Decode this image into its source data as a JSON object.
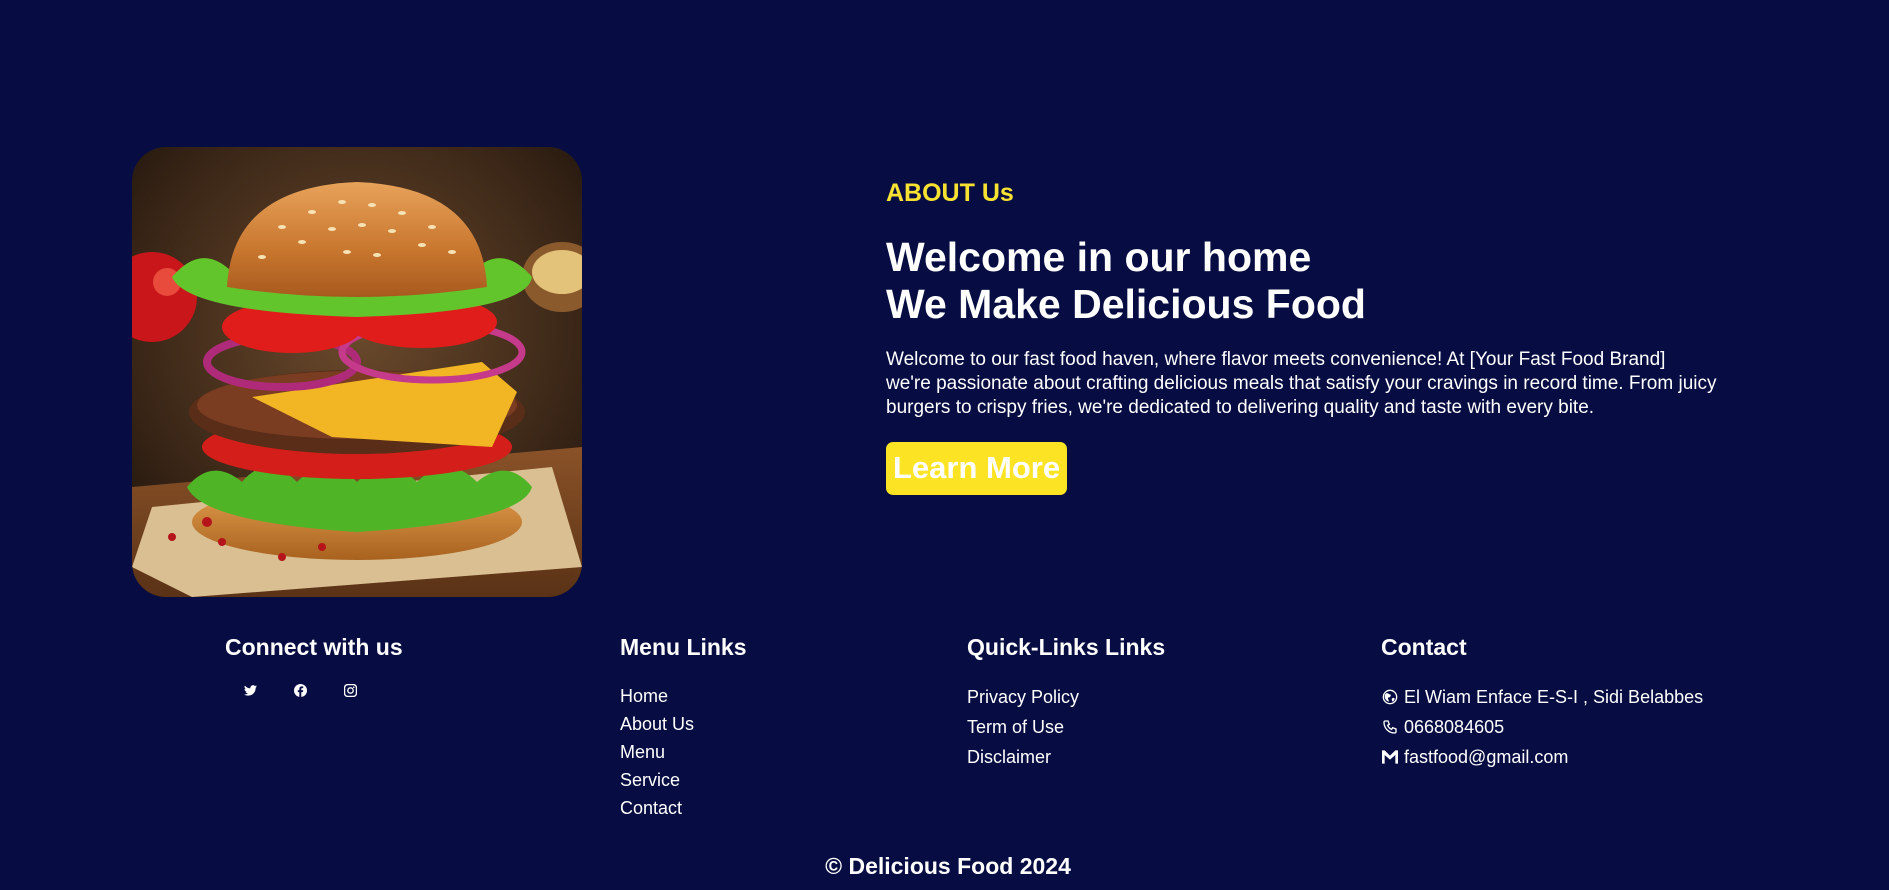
{
  "about": {
    "image_alt": "burger",
    "kicker": "ABOUT Us",
    "title_line1": "Welcome in our home",
    "title_line2": "We Make Delicious Food",
    "desc_line1": "Welcome to our fast food haven, where flavor meets convenience! At [Your Fast Food Brand]",
    "desc_line2": "we're passionate about crafting delicious meals that satisfy your cravings in record time. From juicy",
    "desc_line3": "burgers to crispy fries, we're dedicated to delivering quality and taste with every bite.",
    "button_label": "Learn More"
  },
  "footer": {
    "connect": {
      "heading": "Connect with us",
      "icons": [
        "twitter-icon",
        "facebook-icon",
        "instagram-icon"
      ]
    },
    "menu": {
      "heading": "Menu Links",
      "items": [
        "Home",
        "About Us",
        "Menu",
        "Service",
        "Contact"
      ]
    },
    "quick": {
      "heading": "Quick-Links Links",
      "items": [
        "Privacy Policy",
        "Term of Use",
        "Disclaimer"
      ]
    },
    "contact": {
      "heading": "Contact",
      "address": "El Wiam Enface E-S-I , Sidi Belabbes",
      "phone": "0668084605",
      "email": "fastfood@gmail.com"
    },
    "copyright": "© Delicious Food 2024"
  },
  "colors": {
    "background": "#070d42",
    "accent": "#fce324",
    "text": "#ffffff"
  }
}
